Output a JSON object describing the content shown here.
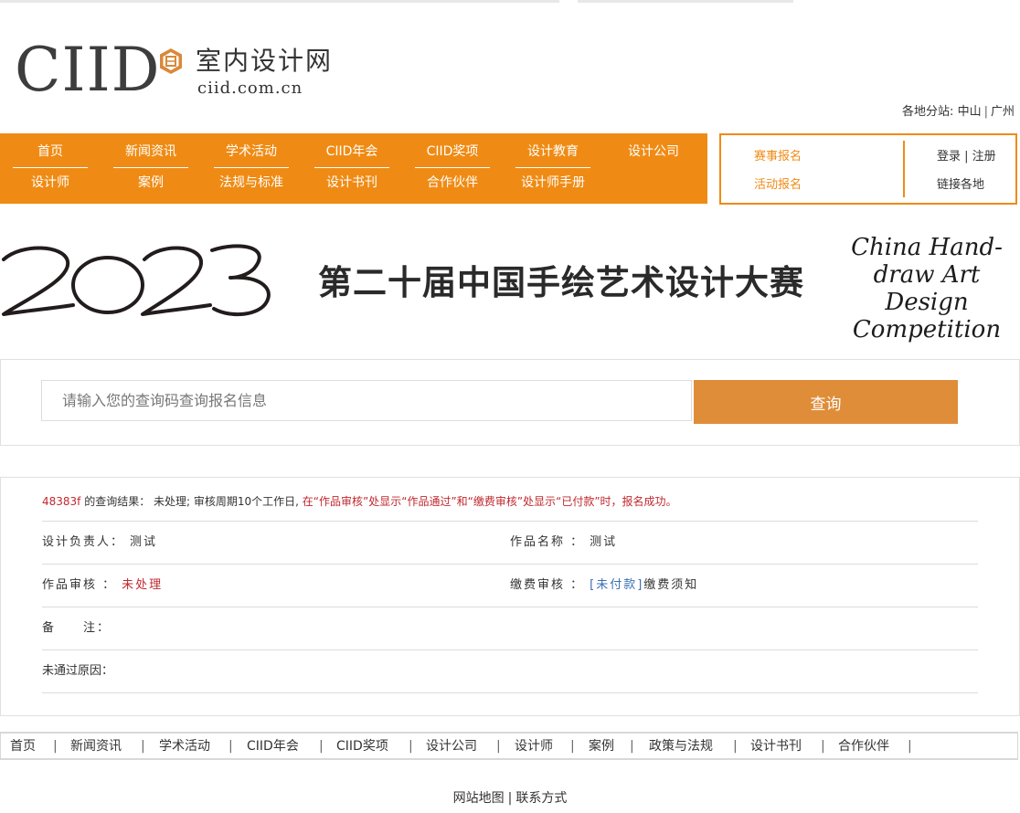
{
  "logo": {
    "ciid": "CIID",
    "cn": "室内设计网",
    "url": "ciid.com.cn"
  },
  "branches": {
    "label": "各地分站:",
    "items": [
      "中山",
      "广州"
    ]
  },
  "nav": {
    "row1": [
      "首页",
      "新闻资讯",
      "学术活动",
      "CIID年会",
      "CIID奖项",
      "设计教育",
      "设计公司"
    ],
    "row2": [
      "设计师",
      "案例",
      "法规与标准",
      "设计书刊",
      "合作伙伴",
      "设计师手册"
    ]
  },
  "side": {
    "event_signup": "赛事报名",
    "activity_signup": "活动报名",
    "login_register": "登录 | 注册",
    "link_branches": "链接各地"
  },
  "banner": {
    "year": "2023",
    "title_cn": "第二十届中国手绘艺术设计大赛",
    "title_en_1": "China Hand-",
    "title_en_2": "draw Art Design",
    "title_en_3": "Competition"
  },
  "search": {
    "placeholder": "请输入您的查询码查询报名信息",
    "button": "查询"
  },
  "result": {
    "code": "48383f",
    "head_mid": " 的查询结果：  未处理; 审核周期10个工作日, ",
    "head_red": "在“作品审核”处显示“作品通过”和“缴费审核”处显示“已付款”时，报名成功。",
    "designer_label": "设计负责人：",
    "designer_value": "测试",
    "work_label": "作品名称 ：",
    "work_value": "测试",
    "review_label": "作品审核 ：",
    "review_value": "未处理",
    "pay_label": "缴费审核 ：",
    "pay_value": "[未付款]",
    "pay_note": "缴费须知",
    "remark_label": "备　　注：",
    "reason_label": "未通过原因："
  },
  "footer": {
    "items": [
      "首页",
      "新闻资讯",
      "学术活动",
      "CIID年会",
      "CIID奖项",
      "设计公司",
      "设计师",
      "案例",
      "政策与法规",
      "设计书刊",
      "合作伙伴"
    ],
    "separator": "|",
    "sitemap": "网站地图",
    "contact": "联系方式"
  },
  "colors": {
    "orange": "#ef8b14",
    "search_button": "#df8d39",
    "red": "#c0282e",
    "blue": "#3b6fb6"
  }
}
